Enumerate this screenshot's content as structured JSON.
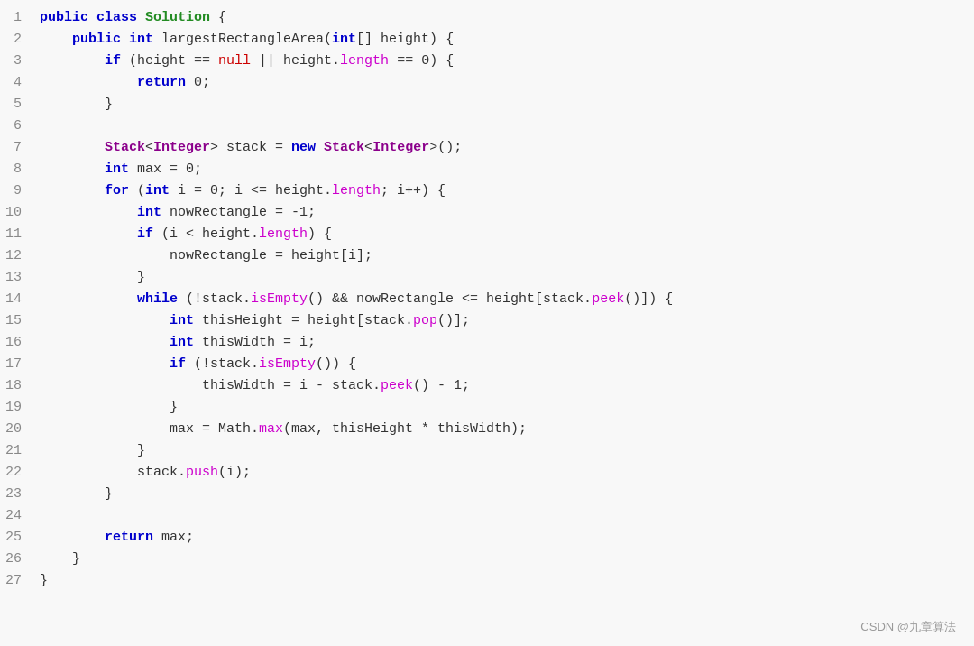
{
  "code": {
    "lines": [
      {
        "num": 1,
        "tokens": [
          {
            "text": "public ",
            "cls": "kw-blue"
          },
          {
            "text": "class ",
            "cls": "kw-blue"
          },
          {
            "text": "Solution",
            "cls": "class-name"
          },
          {
            "text": " {",
            "cls": "normal"
          }
        ]
      },
      {
        "num": 2,
        "tokens": [
          {
            "text": "    public ",
            "cls": "kw-blue"
          },
          {
            "text": "int ",
            "cls": "kw-blue"
          },
          {
            "text": "largestRectangleArea",
            "cls": "normal"
          },
          {
            "text": "(",
            "cls": "normal"
          },
          {
            "text": "int",
            "cls": "kw-blue"
          },
          {
            "text": "[] height) {",
            "cls": "normal"
          }
        ]
      },
      {
        "num": 3,
        "tokens": [
          {
            "text": "        if ",
            "cls": "kw-blue"
          },
          {
            "text": "(height == ",
            "cls": "normal"
          },
          {
            "text": "null",
            "cls": "kw-red"
          },
          {
            "text": " || height.",
            "cls": "normal"
          },
          {
            "text": "length",
            "cls": "method"
          },
          {
            "text": " == 0) {",
            "cls": "normal"
          }
        ]
      },
      {
        "num": 4,
        "tokens": [
          {
            "text": "            return ",
            "cls": "kw-blue"
          },
          {
            "text": "0;",
            "cls": "normal"
          }
        ]
      },
      {
        "num": 5,
        "tokens": [
          {
            "text": "        }",
            "cls": "normal"
          }
        ]
      },
      {
        "num": 6,
        "tokens": []
      },
      {
        "num": 7,
        "tokens": [
          {
            "text": "        Stack",
            "cls": "kw-purple"
          },
          {
            "text": "<",
            "cls": "normal"
          },
          {
            "text": "Integer",
            "cls": "kw-purple"
          },
          {
            "text": "> stack = ",
            "cls": "normal"
          },
          {
            "text": "new ",
            "cls": "kw-blue"
          },
          {
            "text": "Stack",
            "cls": "kw-purple"
          },
          {
            "text": "<",
            "cls": "normal"
          },
          {
            "text": "Integer",
            "cls": "kw-purple"
          },
          {
            "text": ">();",
            "cls": "normal"
          }
        ]
      },
      {
        "num": 8,
        "tokens": [
          {
            "text": "        int ",
            "cls": "kw-blue"
          },
          {
            "text": "max = 0;",
            "cls": "normal"
          }
        ]
      },
      {
        "num": 9,
        "tokens": [
          {
            "text": "        for ",
            "cls": "kw-blue"
          },
          {
            "text": "(",
            "cls": "normal"
          },
          {
            "text": "int ",
            "cls": "kw-blue"
          },
          {
            "text": "i = 0; i <= height.",
            "cls": "normal"
          },
          {
            "text": "length",
            "cls": "method"
          },
          {
            "text": "; i++) {",
            "cls": "normal"
          }
        ]
      },
      {
        "num": 10,
        "tokens": [
          {
            "text": "            int ",
            "cls": "kw-blue"
          },
          {
            "text": "nowRectangle = -1;",
            "cls": "normal"
          }
        ]
      },
      {
        "num": 11,
        "tokens": [
          {
            "text": "            if ",
            "cls": "kw-blue"
          },
          {
            "text": "(i < height.",
            "cls": "normal"
          },
          {
            "text": "length",
            "cls": "method"
          },
          {
            "text": ") {",
            "cls": "normal"
          }
        ]
      },
      {
        "num": 12,
        "tokens": [
          {
            "text": "                nowRectangle = height[i];",
            "cls": "normal"
          }
        ]
      },
      {
        "num": 13,
        "tokens": [
          {
            "text": "            }",
            "cls": "normal"
          }
        ]
      },
      {
        "num": 14,
        "tokens": [
          {
            "text": "            while ",
            "cls": "kw-blue"
          },
          {
            "text": "(!stack.",
            "cls": "normal"
          },
          {
            "text": "isEmpty",
            "cls": "method"
          },
          {
            "text": "() && nowRectangle <= height[stack.",
            "cls": "normal"
          },
          {
            "text": "peek",
            "cls": "method"
          },
          {
            "text": "()]) {",
            "cls": "normal"
          }
        ]
      },
      {
        "num": 15,
        "tokens": [
          {
            "text": "                int ",
            "cls": "kw-blue"
          },
          {
            "text": "thisHeight = height[stack.",
            "cls": "normal"
          },
          {
            "text": "pop",
            "cls": "method"
          },
          {
            "text": "()];",
            "cls": "normal"
          }
        ]
      },
      {
        "num": 16,
        "tokens": [
          {
            "text": "                int ",
            "cls": "kw-blue"
          },
          {
            "text": "thisWidth = i;",
            "cls": "normal"
          }
        ]
      },
      {
        "num": 17,
        "tokens": [
          {
            "text": "                if ",
            "cls": "kw-blue"
          },
          {
            "text": "(!stack.",
            "cls": "normal"
          },
          {
            "text": "isEmpty",
            "cls": "method"
          },
          {
            "text": "()) {",
            "cls": "normal"
          }
        ]
      },
      {
        "num": 18,
        "tokens": [
          {
            "text": "                    thisWidth = i - stack.",
            "cls": "normal"
          },
          {
            "text": "peek",
            "cls": "method"
          },
          {
            "text": "() - 1;",
            "cls": "normal"
          }
        ]
      },
      {
        "num": 19,
        "tokens": [
          {
            "text": "                }",
            "cls": "normal"
          }
        ]
      },
      {
        "num": 20,
        "tokens": [
          {
            "text": "                max = Math.",
            "cls": "normal"
          },
          {
            "text": "max",
            "cls": "method"
          },
          {
            "text": "(max, thisHeight * thisWidth);",
            "cls": "normal"
          }
        ]
      },
      {
        "num": 21,
        "tokens": [
          {
            "text": "            }",
            "cls": "normal"
          }
        ]
      },
      {
        "num": 22,
        "tokens": [
          {
            "text": "            stack.",
            "cls": "normal"
          },
          {
            "text": "push",
            "cls": "method"
          },
          {
            "text": "(i);",
            "cls": "normal"
          }
        ]
      },
      {
        "num": 23,
        "tokens": [
          {
            "text": "        }",
            "cls": "normal"
          }
        ]
      },
      {
        "num": 24,
        "tokens": []
      },
      {
        "num": 25,
        "tokens": [
          {
            "text": "        return ",
            "cls": "kw-blue"
          },
          {
            "text": "max;",
            "cls": "normal"
          }
        ]
      },
      {
        "num": 26,
        "tokens": [
          {
            "text": "    }",
            "cls": "normal"
          }
        ]
      },
      {
        "num": 27,
        "tokens": [
          {
            "text": "}",
            "cls": "normal"
          }
        ]
      }
    ]
  },
  "watermark": {
    "text": "CSDN @九章算法"
  }
}
